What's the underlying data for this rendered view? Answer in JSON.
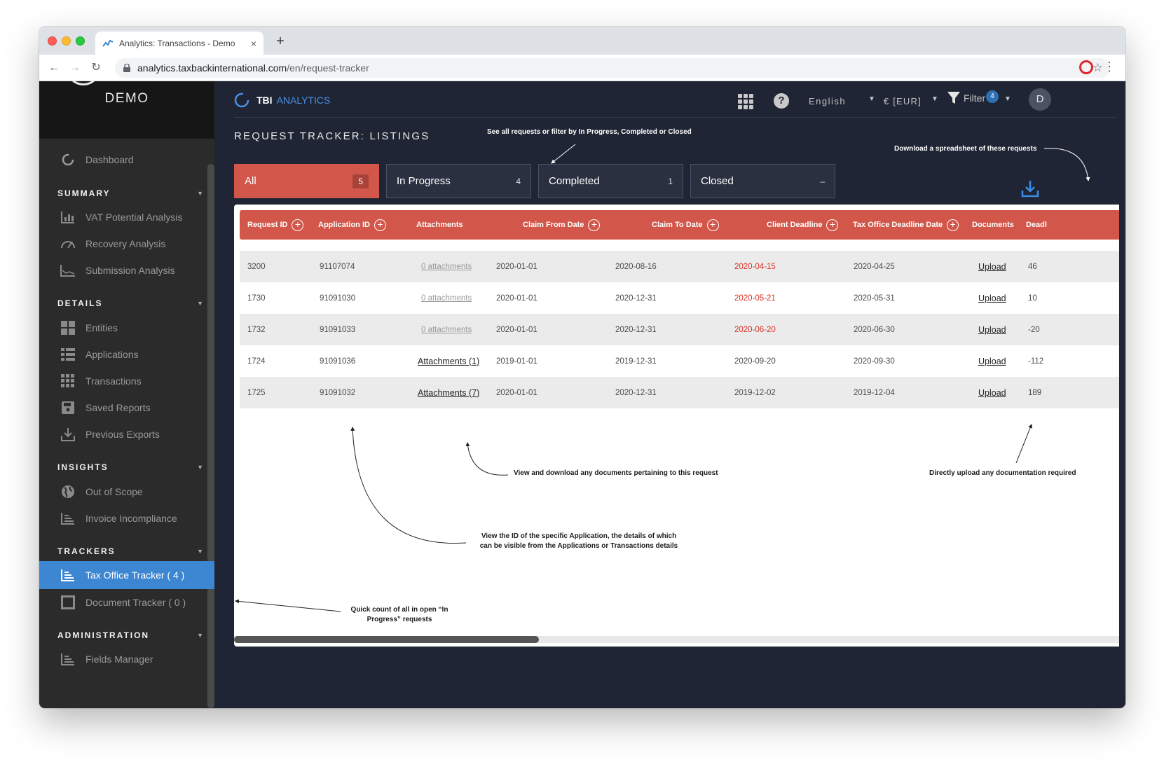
{
  "browser": {
    "tab_title": "Analytics: Transactions - Demo",
    "url_host": "analytics.taxbackinternational.com",
    "url_path": "/en/request-tracker",
    "new_tab": "+",
    "close_tab": "×"
  },
  "sidebar": {
    "brand": "DEMO",
    "items": {
      "dashboard": "Dashboard",
      "vat": "VAT Potential Analysis",
      "recovery": "Recovery Analysis",
      "submission": "Submission Analysis",
      "entities": "Entities",
      "applications": "Applications",
      "transactions": "Transactions",
      "saved_reports": "Saved Reports",
      "previous_exports": "Previous Exports",
      "out_of_scope": "Out of Scope",
      "invoice_incompliance": "Invoice Incompliance",
      "tax_office_tracker": "Tax Office Tracker ( 4 )",
      "document_tracker": "Document Tracker ( 0 )",
      "fields_manager": "Fields Manager"
    },
    "sections": {
      "summary": "SUMMARY",
      "details": "DETAILS",
      "insights": "INSIGHTS",
      "trackers": "TRACKERS",
      "administration": "ADMINISTRATION"
    }
  },
  "topbar": {
    "logo_tbi": "TBI",
    "logo_analytics": "ANALYTICS",
    "help": "?",
    "language": "English",
    "currency": "€ [EUR]",
    "filter_label": "Filter",
    "filter_count": "4",
    "user_initial": "D"
  },
  "page": {
    "title": "REQUEST TRACKER: LISTINGS",
    "status_tabs": [
      {
        "label": "All",
        "count": "5"
      },
      {
        "label": "In Progress",
        "count": "4"
      },
      {
        "label": "Completed",
        "count": "1"
      },
      {
        "label": "Closed",
        "count": "–"
      }
    ]
  },
  "table": {
    "headers": {
      "request_id": "Request ID",
      "application_id": "Application ID",
      "attachments": "Attachments",
      "claim_from": "Claim From Date",
      "claim_to": "Claim To Date",
      "client_deadline": "Client Deadline",
      "tax_office_deadline": "Tax Office Deadline Date",
      "documents": "Documents",
      "deadline": "Deadl"
    },
    "rows": [
      {
        "request_id": "3200",
        "application_id": "91107074",
        "attachments": "0 attachments",
        "claim_from": "2020-01-01",
        "claim_to": "2020-08-16",
        "client_deadline": "2020-04-15",
        "tax_office_deadline": "2020-04-25",
        "documents": "Upload",
        "deadline": "46"
      },
      {
        "request_id": "1730",
        "application_id": "91091030",
        "attachments": "0 attachments",
        "claim_from": "2020-01-01",
        "claim_to": "2020-12-31",
        "client_deadline": "2020-05-21",
        "tax_office_deadline": "2020-05-31",
        "documents": "Upload",
        "deadline": "10"
      },
      {
        "request_id": "1732",
        "application_id": "91091033",
        "attachments": "0 attachments",
        "claim_from": "2020-01-01",
        "claim_to": "2020-12-31",
        "client_deadline": "2020-06-20",
        "tax_office_deadline": "2020-06-30",
        "documents": "Upload",
        "deadline": "-20"
      },
      {
        "request_id": "1724",
        "application_id": "91091036",
        "attachments": "Attachments (1)",
        "claim_from": "2019-01-01",
        "claim_to": "2019-12-31",
        "client_deadline": "2020-09-20",
        "tax_office_deadline": "2020-09-30",
        "documents": "Upload",
        "deadline": "-112"
      },
      {
        "request_id": "1725",
        "application_id": "91091032",
        "attachments": "Attachments (7)",
        "claim_from": "2020-01-01",
        "claim_to": "2020-12-31",
        "client_deadline": "2019-12-02",
        "tax_office_deadline": "2019-12-04",
        "documents": "Upload",
        "deadline": "189"
      }
    ]
  },
  "annotations": {
    "filter_note": "See all requests or filter by In Progress, Completed or Closed",
    "download_note": "Download a spreadsheet of these requests",
    "attachments_note": "View and download any documents pertaining to this request",
    "upload_note": "Directly upload any documentation required",
    "app_id_note_1": "View the ID of the specific Application, the details of which",
    "app_id_note_2": "can be visible from the Applications or Transactions details",
    "count_note_1": "Quick count of all in open “In",
    "count_note_2": "Progress” requests"
  },
  "colors": {
    "accent": "#d2574a",
    "sidebar_active": "#3d86d1",
    "background": "#1f2534",
    "overdue": "#d93025"
  },
  "icons": [
    "favicon-icon",
    "back-icon",
    "forward-icon",
    "reload-icon",
    "lock-icon",
    "star-icon",
    "apps-grid-icon",
    "help-icon",
    "filter-icon",
    "download-icon",
    "plus-circle-icon"
  ]
}
